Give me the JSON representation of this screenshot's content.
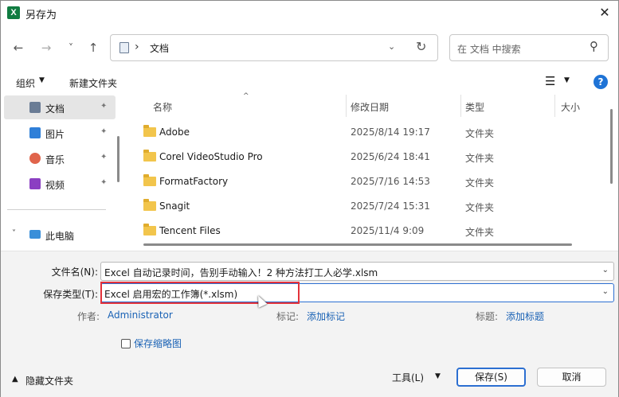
{
  "window": {
    "title": "另存为",
    "app_icon_letter": "X"
  },
  "nav": {
    "back_glyph": "←",
    "forward_glyph": "→",
    "recent_glyph": "˅",
    "up_glyph": "↑",
    "address_sep": "›",
    "address_path": "文档",
    "address_dd": "⌄",
    "refresh_glyph": "↻",
    "search_placeholder": "在 文档 中搜索",
    "search_glyph": "⚲"
  },
  "toolbar": {
    "organize": "组织",
    "new_folder": "新建文件夹",
    "view_glyph": "☰",
    "help_glyph": "?"
  },
  "sidebar": {
    "items": [
      {
        "label": "文档",
        "icon": "documents-icon",
        "color": "#6a7c95",
        "pinned": true
      },
      {
        "label": "图片",
        "icon": "pictures-icon",
        "color": "#2f7fd8",
        "pinned": true
      },
      {
        "label": "音乐",
        "icon": "music-icon",
        "color": "#e0644b",
        "pinned": true
      },
      {
        "label": "视频",
        "icon": "videos-icon",
        "color": "#8b3fc2",
        "pinned": true
      }
    ],
    "pc_label": "此电脑",
    "pin_glyph": "📌",
    "expand_glyph": "˅"
  },
  "filelist": {
    "columns": {
      "name": "名称",
      "date": "修改日期",
      "type": "类型",
      "size": "大小"
    },
    "rows": [
      {
        "name": "Adobe",
        "date": "2025/8/14 19:17",
        "type": "文件夹"
      },
      {
        "name": "Corel VideoStudio Pro",
        "date": "2025/6/24 18:41",
        "type": "文件夹"
      },
      {
        "name": "FormatFactory",
        "date": "2025/7/16 14:53",
        "type": "文件夹"
      },
      {
        "name": "Snagit",
        "date": "2025/7/24 15:31",
        "type": "文件夹"
      },
      {
        "name": "Tencent Files",
        "date": "2025/11/4 9:09",
        "type": "文件夹"
      }
    ]
  },
  "save": {
    "filename_label": "文件名(N):",
    "filename_value": "Excel 自动记录时间，告别手动输入！2 种方法打工人必学.xlsm",
    "type_label": "保存类型(T):",
    "type_value": "Excel 启用宏的工作簿(*.xlsm)",
    "author_label": "作者:",
    "author_value": "Administrator",
    "tags_label": "标记:",
    "tags_value": "添加标记",
    "title_label": "标题:",
    "title_value": "添加标题",
    "thumbnail_label": "保存缩略图",
    "hide_folders": "隐藏文件夹",
    "tools": "工具(L)",
    "save_button": "保存(S)",
    "cancel_button": "取消",
    "highlight_color": "#e3323a"
  }
}
